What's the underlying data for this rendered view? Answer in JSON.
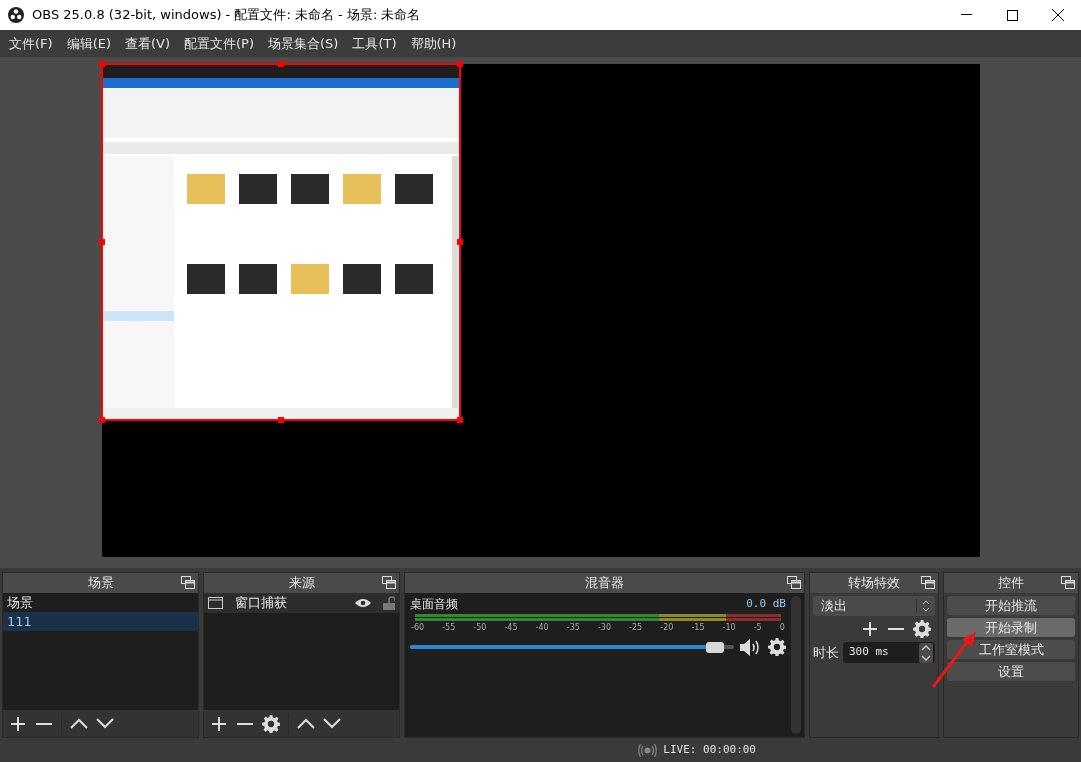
{
  "window": {
    "title": "OBS 25.0.8 (32-bit, windows) - 配置文件: 未命名 - 场景: 未命名"
  },
  "menu": [
    "文件(F)",
    "编辑(E)",
    "查看(V)",
    "配置文件(P)",
    "场景集合(S)",
    "工具(T)",
    "帮助(H)"
  ],
  "preview": {
    "source_selected": true
  },
  "scenes": {
    "title": "场景",
    "items": [
      {
        "label": "场景",
        "selected": false
      },
      {
        "label": "111",
        "selected": true
      }
    ]
  },
  "sources": {
    "title": "来源",
    "items": [
      {
        "label": "窗口捕获",
        "visible": true,
        "locked": false
      }
    ]
  },
  "mixer": {
    "title": "混音器",
    "channels": [
      {
        "name": "桌面音频",
        "reading": "0.0 dB",
        "level": 0.97,
        "muted": false,
        "scale": [
          "-60",
          "-55",
          "-50",
          "-45",
          "-40",
          "-35",
          "-30",
          "-25",
          "-20",
          "-15",
          "-10",
          "-5",
          "0"
        ]
      }
    ]
  },
  "transitions": {
    "title": "转场特效",
    "selected": "淡出",
    "duration_label": "时长",
    "duration": "300 ms"
  },
  "controls": {
    "title": "控件",
    "buttons": [
      {
        "label": "开始推流",
        "highlighted": false
      },
      {
        "label": "开始录制",
        "highlighted": true
      },
      {
        "label": "工作室模式",
        "highlighted": false
      },
      {
        "label": "设置",
        "highlighted": false
      }
    ]
  },
  "status_bar": {
    "live": "LIVE: 00:00:00"
  }
}
